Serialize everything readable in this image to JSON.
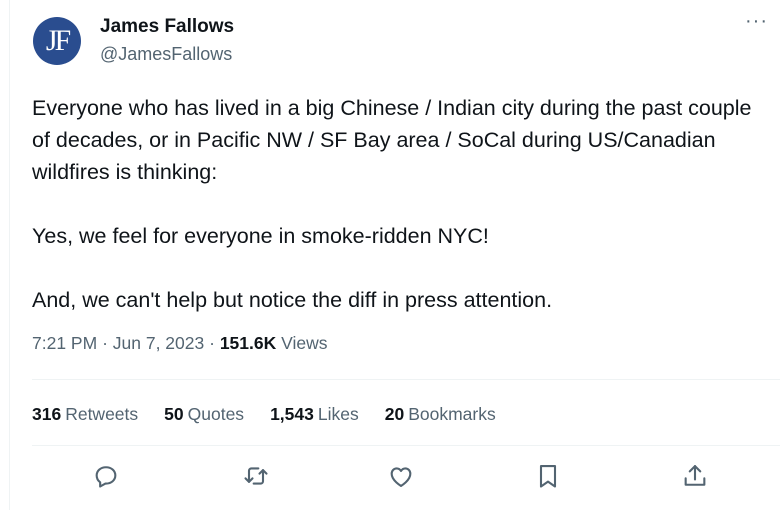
{
  "author": {
    "avatar_letter": "JF",
    "avatar_color": "#2a4d8f",
    "display_name": "James Fallows",
    "handle": "@JamesFallows"
  },
  "more_label": "···",
  "tweet": {
    "paragraphs": [
      "Everyone who has lived in a big Chinese / Indian city during the past couple of decades, or in  Pacific NW / SF Bay area / SoCal during US/Canadian wildfires is thinking:",
      "Yes, we feel for everyone in smoke-ridden NYC!",
      "And, we can't help but notice the diff in press attention."
    ]
  },
  "meta": {
    "time": "7:21 PM",
    "sep1": "·",
    "date": "Jun 7, 2023",
    "sep2": "·",
    "views_count": "151.6K",
    "views_label": "Views"
  },
  "stats": {
    "retweets": {
      "count": "316",
      "label": "Retweets"
    },
    "quotes": {
      "count": "50",
      "label": "Quotes"
    },
    "likes": {
      "count": "1,543",
      "label": "Likes"
    },
    "bookmarks": {
      "count": "20",
      "label": "Bookmarks"
    }
  },
  "actions": [
    "reply-icon",
    "retweet-icon",
    "like-icon",
    "bookmark-icon",
    "share-icon"
  ],
  "colors": {
    "text": "#0f1419",
    "secondary": "#536471",
    "divider": "#eff3f4"
  }
}
